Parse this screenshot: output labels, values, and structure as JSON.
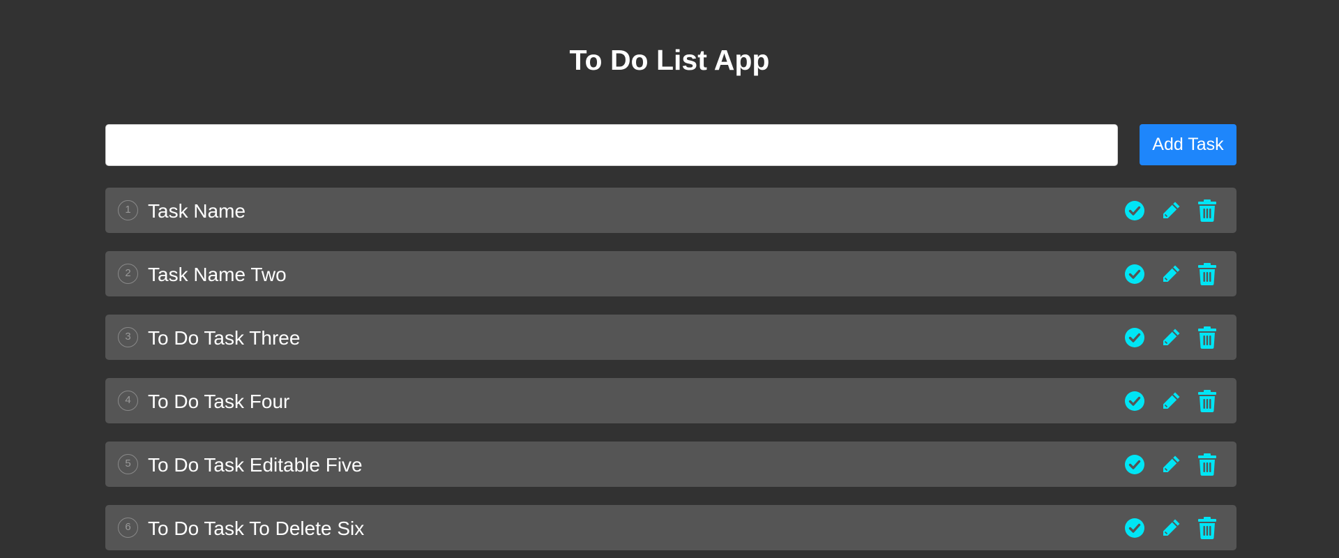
{
  "app": {
    "title": "To Do List App"
  },
  "add_form": {
    "input_value": "",
    "button_label": "Add Task"
  },
  "tasks": [
    {
      "number": "1",
      "text": "Task Name"
    },
    {
      "number": "2",
      "text": "Task Name Two"
    },
    {
      "number": "3",
      "text": "To Do Task Three"
    },
    {
      "number": "4",
      "text": "To Do Task Four"
    },
    {
      "number": "5",
      "text": "To Do Task Editable Five"
    },
    {
      "number": "6",
      "text": "To Do Task To Delete Six"
    }
  ],
  "icons": {
    "complete": "check-circle-icon",
    "edit": "pencil-icon",
    "delete": "trash-icon"
  },
  "colors": {
    "background": "#323232",
    "task_background": "#555555",
    "accent": "#00e5f5",
    "button": "#1e86fb"
  }
}
